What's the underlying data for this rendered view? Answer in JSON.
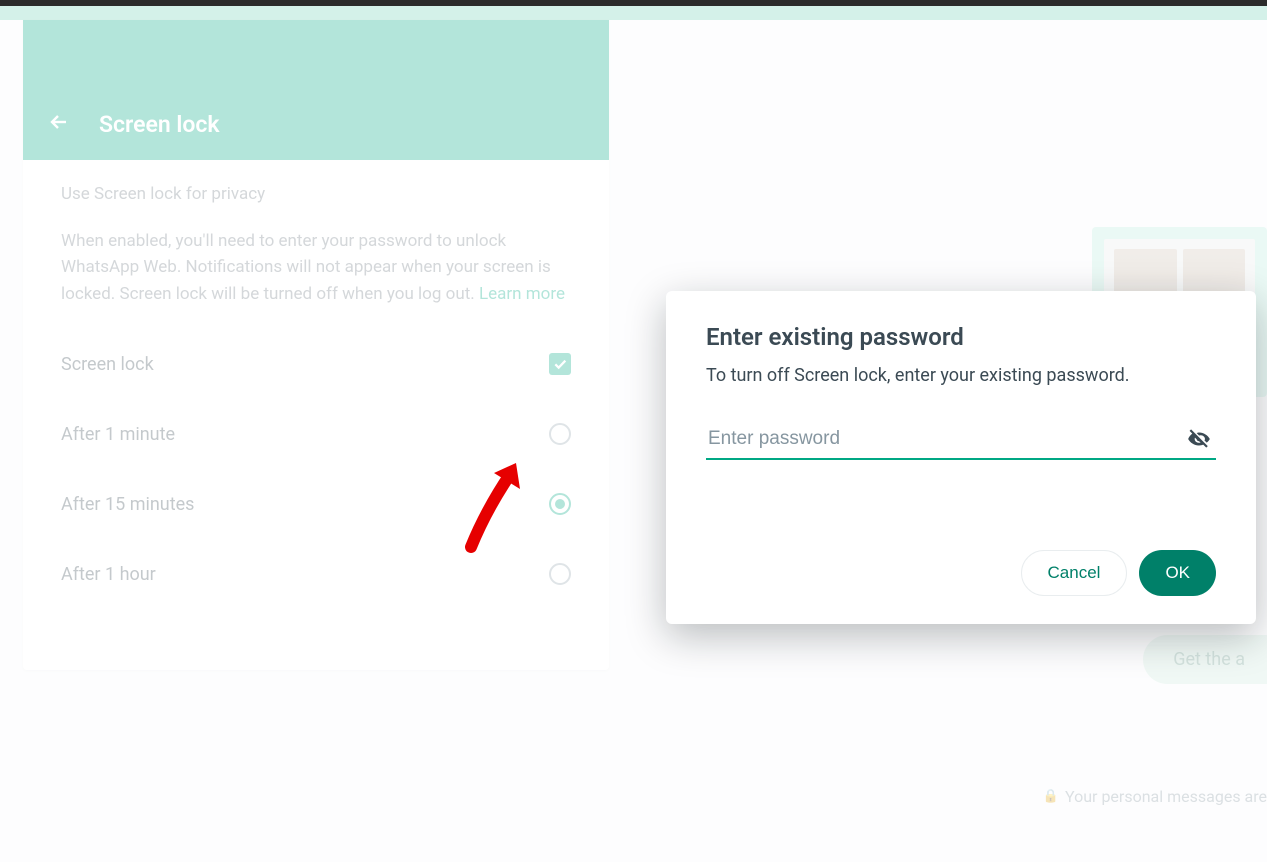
{
  "sidebar": {
    "title": "Screen lock",
    "privacy_line": "Use Screen lock for privacy",
    "description": "When enabled, you'll need to enter your password to unlock WhatsApp Web. Notifications will not appear when your screen is locked. Screen lock will be turned off when you log out. ",
    "learn_more": "Learn more",
    "toggle_label": "Screen lock",
    "options": [
      {
        "label": "After 1 minute",
        "selected": false
      },
      {
        "label": "After 15 minutes",
        "selected": true
      },
      {
        "label": "After 1 hour",
        "selected": false
      }
    ]
  },
  "dialog": {
    "title": "Enter existing password",
    "description": "To turn off Screen lock, enter your existing password.",
    "placeholder": "Enter password",
    "cancel": "Cancel",
    "ok": "OK"
  },
  "promo": {
    "cta": "Get the a"
  },
  "footer": {
    "text": "Your personal messages are"
  }
}
